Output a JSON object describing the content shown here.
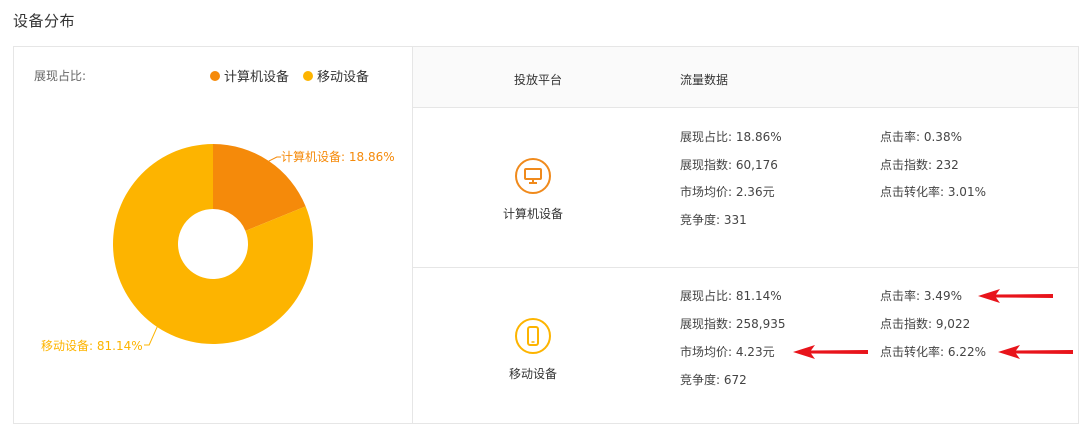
{
  "title": "设备分布",
  "chart": {
    "label": "展现占比:",
    "legend": [
      {
        "name": "计算机设备",
        "color": "#f58a0a"
      },
      {
        "name": "移动设备",
        "color": "#fdb400"
      }
    ]
  },
  "chart_data": {
    "type": "pie",
    "categories": [
      "计算机设备",
      "移动设备"
    ],
    "values": [
      18.86,
      81.14
    ],
    "colors": [
      "#f58a0a",
      "#fdb400"
    ],
    "donut": true,
    "data_labels": [
      "计算机设备: 18.86%",
      "移动设备: 81.14%"
    ],
    "legend_position": "top-right"
  },
  "table": {
    "headers": [
      "投放平台",
      "流量数据"
    ],
    "rows": [
      {
        "device": "计算机设备",
        "icon": "monitor-icon",
        "icon_color": "#f08a1c",
        "stats": [
          "展现占比: 18.86%",
          "点击率: 0.38%",
          "展现指数: 60,176",
          "点击指数: 232",
          "市场均价: 2.36元",
          "点击转化率: 3.01%",
          "竞争度: 331"
        ]
      },
      {
        "device": "移动设备",
        "icon": "mobile-icon",
        "icon_color": "#fdb400",
        "stats": [
          "展现占比: 81.14%",
          "点击率: 3.49%",
          "展现指数: 258,935",
          "点击指数: 9,022",
          "市场均价: 4.23元",
          "点击转化率: 6.22%",
          "竞争度: 672"
        ]
      }
    ]
  },
  "annotation_color": "#e8141b"
}
